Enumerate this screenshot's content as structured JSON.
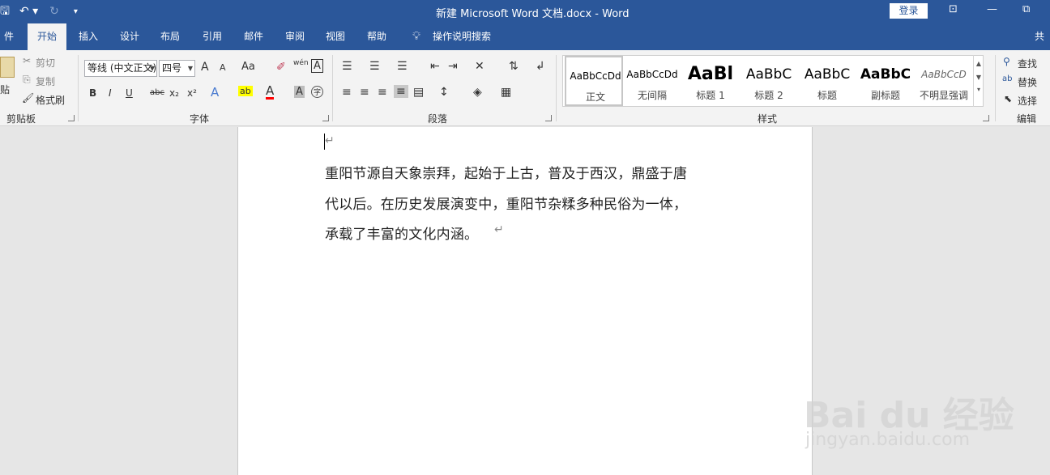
{
  "window": {
    "title": "新建 Microsoft Word 文档.docx  -  Word",
    "login": "登录",
    "minimize": "—",
    "restore": "⧉",
    "qat": {
      "save": "🖫",
      "undo": "↶ ▾",
      "redo": "↻",
      "customize": "▾"
    },
    "ribbon_display": "⊡"
  },
  "tabs": [
    {
      "label": "件"
    },
    {
      "label": "开始"
    },
    {
      "label": "插入"
    },
    {
      "label": "设计"
    },
    {
      "label": "布局"
    },
    {
      "label": "引用"
    },
    {
      "label": "邮件"
    },
    {
      "label": "审阅"
    },
    {
      "label": "视图"
    },
    {
      "label": "帮助"
    },
    {
      "label": "操作说明搜索"
    },
    {
      "label": "共"
    }
  ],
  "tell_me_icon": "lightbulb-icon",
  "clipboard": {
    "paste": "贴",
    "cut": "剪切",
    "copy": "复制",
    "format_painter": "格式刷",
    "label": "剪贴板"
  },
  "font": {
    "font_name": "等线 (中文正文)",
    "font_size": "四号",
    "grow": "A",
    "shrink": "A",
    "change_case": "Aa",
    "clear_format": "✐",
    "phonetic": "wén",
    "char_border": "A",
    "bold": "B",
    "italic": "I",
    "underline": "U",
    "strike": "abc",
    "subscript": "x₂",
    "superscript": "x²",
    "text_effects": "A",
    "highlight": "ab",
    "font_color": "A",
    "char_shading": "A",
    "enclose": "字",
    "label": "字体"
  },
  "paragraph": {
    "label": "段落"
  },
  "styles": {
    "label": "样式",
    "items": [
      {
        "preview": "AaBbCcDd",
        "name": "正文"
      },
      {
        "preview": "AaBbCcDd",
        "name": "无间隔"
      },
      {
        "preview": "AaBl",
        "name": "标题 1"
      },
      {
        "preview": "AaBbC",
        "name": "标题 2"
      },
      {
        "preview": "AaBbC",
        "name": "标题"
      },
      {
        "preview": "AaBbC",
        "name": "副标题"
      },
      {
        "preview": "AaBbCcD",
        "name": "不明显强调"
      }
    ]
  },
  "editing": {
    "find": "查找",
    "replace": "替换",
    "select": "选择",
    "label": "编辑"
  },
  "document": {
    "empty_mark": "↵",
    "lines": [
      "重阳节源自天象崇拜，起始于上古，普及于西汉，鼎盛于唐",
      "代以后。在历史发展演变中，重阳节杂糅多种民俗为一体，",
      "承载了丰富的文化内涵。"
    ],
    "end_mark": "↵"
  },
  "watermark": {
    "brand": "Bai du 经验",
    "url": "jingyan.baidu.com"
  },
  "colors": {
    "accent": "#2b579a",
    "ribbon": "#f3f3f3",
    "highlight": "#ffff00",
    "font_color": "#ff0000"
  }
}
